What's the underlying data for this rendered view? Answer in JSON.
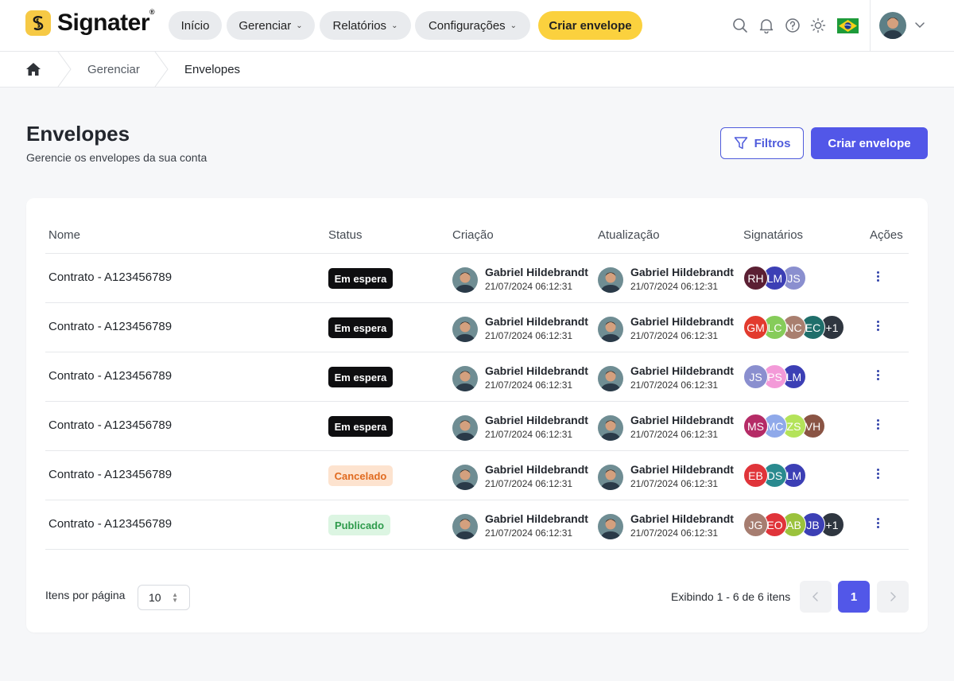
{
  "brand": {
    "name": "Signater",
    "reg": "®",
    "yellow": "#FBD13E",
    "primary": "#5257E8"
  },
  "nav": {
    "inicio": "Início",
    "gerenciar": "Gerenciar",
    "relatorios": "Relatórios",
    "configuracoes": "Configurações",
    "criar_envelope": "Criar envelope"
  },
  "breadcrumb": {
    "gerenciar": "Gerenciar",
    "envelopes": "Envelopes"
  },
  "header": {
    "title": "Envelopes",
    "subtitle": "Gerencie os envelopes da sua conta",
    "filters_label": "Filtros",
    "create_label": "Criar envelope"
  },
  "table": {
    "columns": {
      "nome": "Nome",
      "status": "Status",
      "criacao": "Criação",
      "atualizacao": "Atualização",
      "signatarios": "Signatários",
      "acoes": "Ações"
    },
    "rows": [
      {
        "name": "Contrato - A123456789",
        "status": "Em espera",
        "status_type": "waiting",
        "created_by": "Gabriel Hildebrandt",
        "created_at": "21/07/2024 06:12:31",
        "updated_by": "Gabriel Hildebrandt",
        "updated_at": "21/07/2024 06:12:31",
        "signers": [
          {
            "initials": "RH",
            "color": "#5b1f33"
          },
          {
            "initials": "LM",
            "color": "#3c3fb5"
          },
          {
            "initials": "JS",
            "color": "#8a8fcf"
          }
        ]
      },
      {
        "name": "Contrato - A123456789",
        "status": "Em espera",
        "status_type": "waiting",
        "created_by": "Gabriel Hildebrandt",
        "created_at": "21/07/2024 06:12:31",
        "updated_by": "Gabriel Hildebrandt",
        "updated_at": "21/07/2024 06:12:31",
        "signers": [
          {
            "initials": "GM",
            "color": "#e23b2e"
          },
          {
            "initials": "LC",
            "color": "#86cc5a"
          },
          {
            "initials": "NC",
            "color": "#a97f6f"
          },
          {
            "initials": "EC",
            "color": "#1f6e6a"
          },
          {
            "initials": "+1",
            "color": "#2f3640"
          }
        ]
      },
      {
        "name": "Contrato - A123456789",
        "status": "Em espera",
        "status_type": "waiting",
        "created_by": "Gabriel Hildebrandt",
        "created_at": "21/07/2024 06:12:31",
        "updated_by": "Gabriel Hildebrandt",
        "updated_at": "21/07/2024 06:12:31",
        "signers": [
          {
            "initials": "JS",
            "color": "#8a8fcf"
          },
          {
            "initials": "PS",
            "color": "#f39ad8"
          },
          {
            "initials": "LM",
            "color": "#3c3fb5"
          }
        ]
      },
      {
        "name": "Contrato - A123456789",
        "status": "Em espera",
        "status_type": "waiting",
        "created_by": "Gabriel Hildebrandt",
        "created_at": "21/07/2024 06:12:31",
        "updated_by": "Gabriel Hildebrandt",
        "updated_at": "21/07/2024 06:12:31",
        "signers": [
          {
            "initials": "MS",
            "color": "#b52b66"
          },
          {
            "initials": "MC",
            "color": "#8fa9ea"
          },
          {
            "initials": "ZS",
            "color": "#b4e35a"
          },
          {
            "initials": "VH",
            "color": "#8a5444"
          }
        ]
      },
      {
        "name": "Contrato - A123456789",
        "status": "Cancelado",
        "status_type": "cancelled",
        "created_by": "Gabriel Hildebrandt",
        "created_at": "21/07/2024 06:12:31",
        "updated_by": "Gabriel Hildebrandt",
        "updated_at": "21/07/2024 06:12:31",
        "signers": [
          {
            "initials": "EB",
            "color": "#e0343a"
          },
          {
            "initials": "DS",
            "color": "#2a8a8f"
          },
          {
            "initials": "LM",
            "color": "#3c3fb5"
          }
        ]
      },
      {
        "name": "Contrato - A123456789",
        "status": "Publicado",
        "status_type": "published",
        "created_by": "Gabriel Hildebrandt",
        "created_at": "21/07/2024 06:12:31",
        "updated_by": "Gabriel Hildebrandt",
        "updated_at": "21/07/2024 06:12:31",
        "signers": [
          {
            "initials": "JG",
            "color": "#a67d70"
          },
          {
            "initials": "EO",
            "color": "#e0343a"
          },
          {
            "initials": "AB",
            "color": "#9bc23c"
          },
          {
            "initials": "JB",
            "color": "#3c3fb5"
          },
          {
            "initials": "+1",
            "color": "#2f3640"
          }
        ]
      }
    ]
  },
  "status_colors": {
    "waiting": {
      "bg": "#0e0e10",
      "fg": "#ffffff"
    },
    "cancelled": {
      "bg": "#fde3cf",
      "fg": "#e06a1f"
    },
    "published": {
      "bg": "#dcf5e2",
      "fg": "#2e9b4c"
    }
  },
  "footer": {
    "per_page_label": "Itens por página",
    "per_page_value": "10",
    "showing": "Exibindo 1 - 6 de 6 itens",
    "current_page": "1"
  }
}
